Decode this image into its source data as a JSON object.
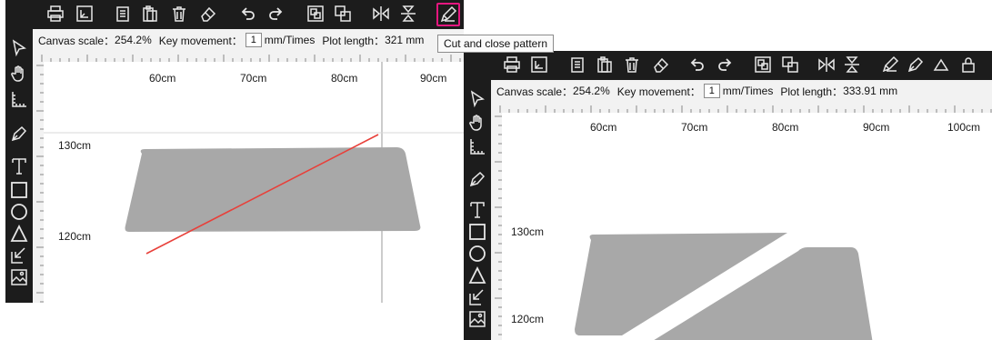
{
  "left_window": {
    "status": {
      "canvas_scale_label": "Canvas scale：",
      "canvas_scale_value": "254.2%",
      "key_movement_label": "Key movement：",
      "key_movement_value": "1",
      "key_movement_unit": "mm/Times",
      "plot_length_label": "Plot length：",
      "plot_length_value": "321 mm"
    },
    "x_labels": [
      "60cm",
      "70cm",
      "80cm",
      "90cm"
    ],
    "y_labels": [
      "130cm",
      "120cm"
    ],
    "tooltip": "Cut and close pattern"
  },
  "right_window": {
    "status": {
      "canvas_scale_label": "Canvas scale：",
      "canvas_scale_value": "254.2%",
      "key_movement_label": "Key movement：",
      "key_movement_value": "1",
      "key_movement_unit": "mm/Times",
      "plot_length_label": "Plot length：",
      "plot_length_value": "333.91 mm"
    },
    "x_labels": [
      "60cm",
      "70cm",
      "80cm",
      "90cm",
      "100cm"
    ],
    "y_labels": [
      "130cm",
      "120cm"
    ]
  },
  "toolbar_icons": [
    "print-icon",
    "export-icon",
    "copy-icon",
    "paste-icon",
    "delete-icon",
    "eraser-icon",
    "undo-icon",
    "redo-icon",
    "group-icon",
    "ungroup-icon",
    "flip-horizontal-icon",
    "flip-vertical-icon",
    "cut-close-pattern-icon",
    "pen-icon",
    "shape-icon",
    "lock-icon"
  ],
  "sidebar_icons": [
    "select-arrow-icon",
    "hand-icon",
    "measure-icon",
    "pen-tool-icon",
    "text-icon",
    "rectangle-icon",
    "circle-icon",
    "triangle-icon",
    "import-icon",
    "image-icon"
  ],
  "colors": {
    "toolbar_bg": "#1c1c1c",
    "highlight": "#e5177f",
    "pattern_fill": "#a8a8a8",
    "cut_line": "#e8403a"
  }
}
